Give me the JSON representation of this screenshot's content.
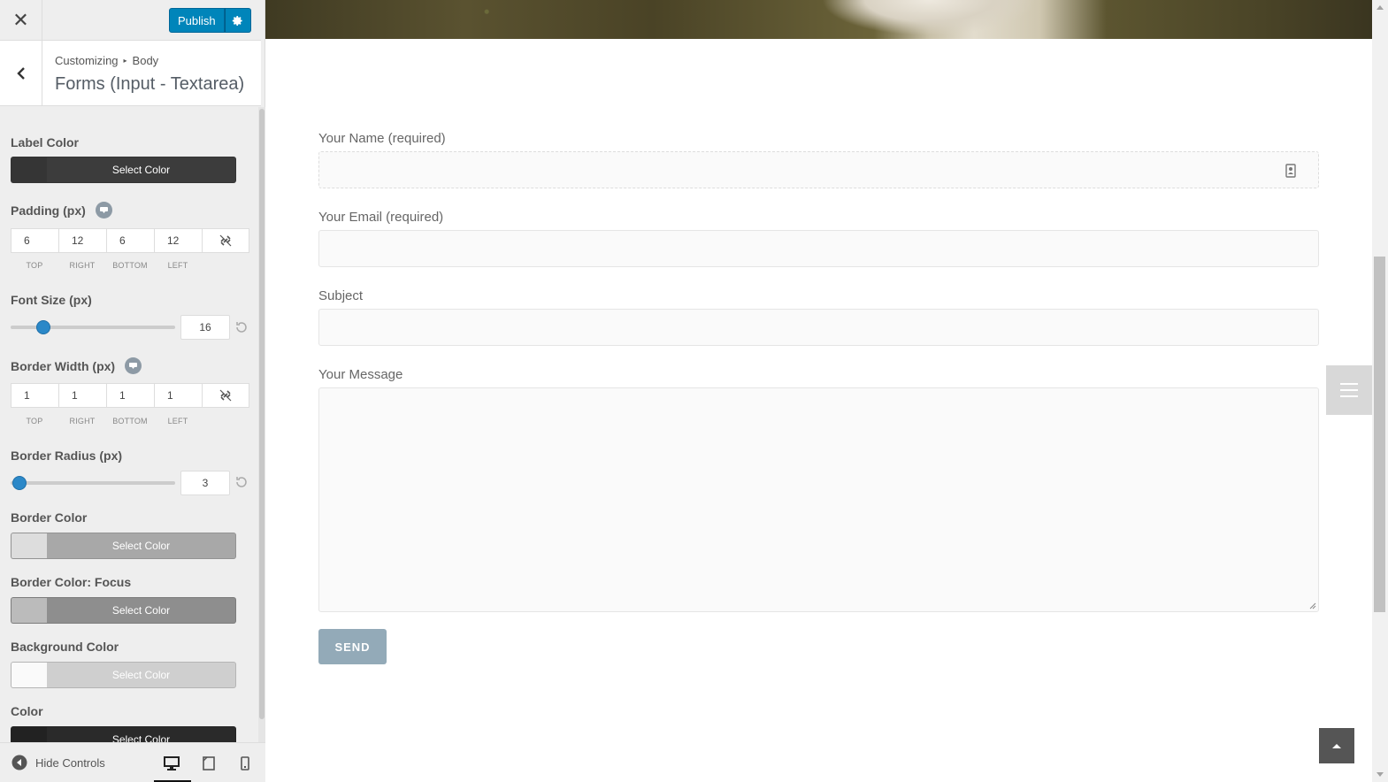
{
  "header": {
    "publish_label": "Publish"
  },
  "section": {
    "breadcrumb_root": "Customizing",
    "breadcrumb_child": "Body",
    "title": "Forms (Input - Textarea)"
  },
  "controls": {
    "label_color": {
      "label": "Label Color",
      "button": "Select Color",
      "swatch": "#3c3c3c"
    },
    "padding": {
      "label": "Padding (px)",
      "values": [
        "6",
        "12",
        "6",
        "12"
      ],
      "sides": [
        "TOP",
        "RIGHT",
        "BOTTOM",
        "LEFT"
      ]
    },
    "font_size": {
      "label": "Font Size (px)",
      "value": "16",
      "fraction": 0.18
    },
    "border_width": {
      "label": "Border Width (px)",
      "values": [
        "1",
        "1",
        "1",
        "1"
      ],
      "sides": [
        "TOP",
        "RIGHT",
        "BOTTOM",
        "LEFT"
      ]
    },
    "border_radius": {
      "label": "Border Radius (px)",
      "value": "3",
      "fraction": 0.06
    },
    "border_color": {
      "label": "Border Color",
      "button": "Select Color",
      "swatch": "#dddddd"
    },
    "border_color_focus": {
      "label": "Border Color: Focus",
      "button": "Select Color",
      "swatch": "#bbbbbb"
    },
    "background_color": {
      "label": "Background Color",
      "button": "Select Color",
      "swatch": "#fafafa"
    },
    "color": {
      "label": "Color",
      "button": "Select Color",
      "swatch": "#222222"
    }
  },
  "footer": {
    "hide_controls": "Hide Controls"
  },
  "form": {
    "name_label": "Your Name (required)",
    "email_label": "Your Email (required)",
    "subject_label": "Subject",
    "message_label": "Your Message",
    "send_label": "SEND"
  },
  "colors": {
    "accent": "#0085ba",
    "slider_knob": "#2b88c8",
    "send_button": "#93aab8"
  }
}
